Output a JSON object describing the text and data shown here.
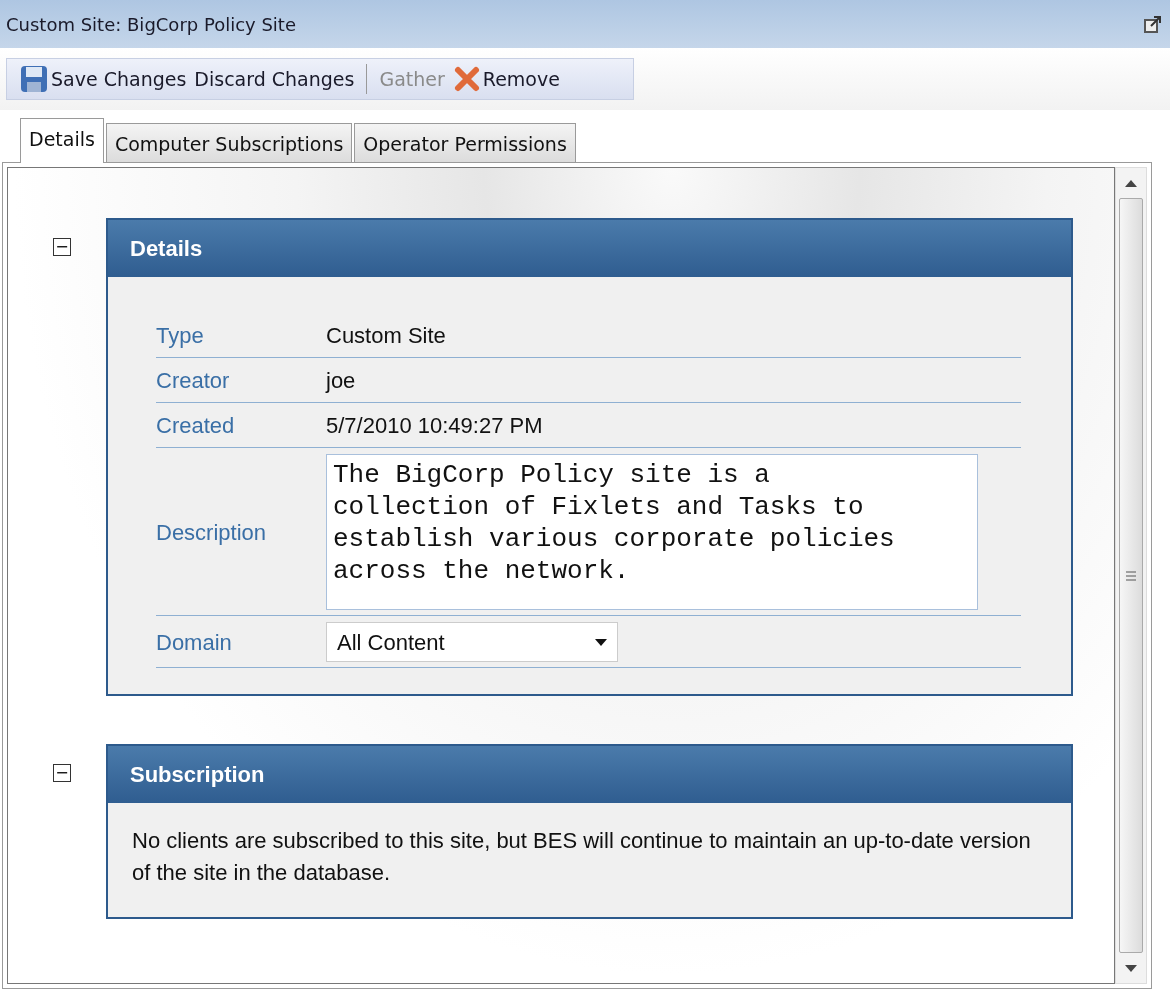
{
  "window": {
    "title": "Custom Site: BigCorp Policy Site"
  },
  "toolbar": [
    {
      "kind": "save",
      "label": "Save Changes",
      "disabled": false
    },
    {
      "kind": "plain",
      "label": "Discard Changes",
      "disabled": false
    },
    {
      "kind": "separator"
    },
    {
      "kind": "plain",
      "label": "Gather",
      "disabled": true
    },
    {
      "kind": "remove",
      "label": "Remove",
      "disabled": false
    }
  ],
  "tabs": [
    {
      "label": "Details",
      "selected": true
    },
    {
      "label": "Computer Subscriptions",
      "selected": false
    },
    {
      "label": "Operator Permissions",
      "selected": false
    }
  ],
  "sections": [
    {
      "title": "Details",
      "expanded": true,
      "collapse_icon": "−",
      "kind": "fields",
      "fields": [
        {
          "kind": "text",
          "label": "Type",
          "value": "Custom Site"
        },
        {
          "kind": "text",
          "label": "Creator",
          "value": "joe"
        },
        {
          "kind": "text",
          "label": "Created",
          "value": "5/7/2010 10:49:27 PM"
        },
        {
          "kind": "textarea",
          "label": "Description",
          "value": "The BigCorp Policy site is a collection of Fixlets and Tasks to establish various corporate policies across the network."
        },
        {
          "kind": "select",
          "label": "Domain",
          "value": "All Content"
        }
      ]
    },
    {
      "title": "Subscription",
      "expanded": true,
      "collapse_icon": "−",
      "kind": "text",
      "text": "No clients are subscribed to this site, but BES will continue to maintain an up-to-date version of the site in the database."
    }
  ]
}
